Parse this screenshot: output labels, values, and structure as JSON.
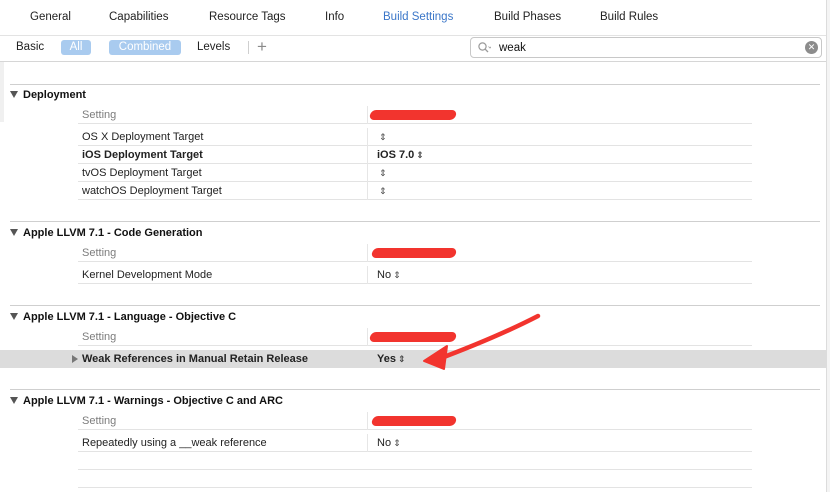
{
  "tabs": [
    {
      "label": "General"
    },
    {
      "label": "Capabilities"
    },
    {
      "label": "Resource Tags"
    },
    {
      "label": "Info"
    },
    {
      "label": "Build Settings"
    },
    {
      "label": "Build Phases"
    },
    {
      "label": "Build Rules"
    }
  ],
  "toolbar": {
    "basic": "Basic",
    "all": "All",
    "combined": "Combined",
    "levels": "Levels",
    "plus": "+"
  },
  "search": {
    "value": "weak"
  },
  "sections": [
    {
      "title": "Deployment",
      "header_col": "Setting",
      "rows": [
        {
          "name": "OS X Deployment Target",
          "value": ""
        },
        {
          "name": "iOS Deployment Target",
          "value": "iOS 7.0"
        },
        {
          "name": "tvOS Deployment Target",
          "value": ""
        },
        {
          "name": "watchOS Deployment Target",
          "value": ""
        }
      ]
    },
    {
      "title": "Apple LLVM 7.1 - Code Generation",
      "header_col": "Setting",
      "rows": [
        {
          "name": "Kernel Development Mode",
          "value": "No"
        }
      ]
    },
    {
      "title": "Apple LLVM 7.1 - Language - Objective C",
      "header_col": "Setting",
      "rows": [
        {
          "name": "Weak References in Manual Retain Release",
          "value": "Yes"
        }
      ]
    },
    {
      "title": "Apple LLVM 7.1 - Warnings - Objective C and ARC",
      "header_col": "Setting",
      "rows": [
        {
          "name": "Repeatedly using a __weak reference",
          "value": "No"
        }
      ]
    }
  ],
  "glyphs": {
    "stepper": "⌃⌄",
    "updown": "⇕",
    "clear": "✕"
  },
  "colors": {
    "active_tab": "#3a76c8",
    "highlight_row": "#dcdcdc",
    "annotation": "#f2342e",
    "pill": "#a9cbef"
  }
}
